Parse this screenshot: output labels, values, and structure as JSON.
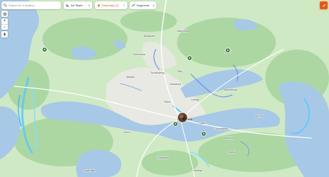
{
  "search": {
    "placeholder": "Search for a location",
    "value": ""
  },
  "toolbar": {
    "sport_label": "Ice Skate",
    "heatmaps_label": "Heatmaps (1)",
    "segments_label": "Segments"
  },
  "colors": {
    "accent": "#fc5200",
    "land": "#cfe9c4",
    "forest": "#a9d6a0",
    "water": "#a7c8e6",
    "heat": "#5bc8ff"
  },
  "map": {
    "places": [
      {
        "name": "Sjöbjacka",
        "kind": "label"
      },
      {
        "name": "Ljusterö",
        "kind": "label"
      },
      {
        "name": "Vallentuna",
        "kind": "label"
      },
      {
        "name": "Sollentuna",
        "kind": "label"
      },
      {
        "name": "Täby",
        "kind": "label"
      },
      {
        "name": "Danderyd",
        "kind": "label"
      },
      {
        "name": "Järfälla",
        "kind": "label"
      },
      {
        "name": "Sundbyberg",
        "kind": "label"
      },
      {
        "name": "Lidingö",
        "kind": "label"
      },
      {
        "name": "Solna",
        "kind": "label"
      },
      {
        "name": "Stockholm",
        "kind": "city"
      },
      {
        "name": "Nacka",
        "kind": "label"
      },
      {
        "name": "Ekerö",
        "kind": "label"
      },
      {
        "name": "Huddinge",
        "kind": "label"
      },
      {
        "name": "Tyresö",
        "kind": "label"
      },
      {
        "name": "Värmdö",
        "kind": "label"
      },
      {
        "name": "Åkersberga",
        "kind": "label"
      },
      {
        "name": "Södertälje",
        "kind": "label"
      },
      {
        "name": "Vaxholm",
        "kind": "label"
      },
      {
        "name": "Gustavsberg",
        "kind": "label"
      },
      {
        "name": "Haninge",
        "kind": "label"
      }
    ],
    "pins": [
      "tree-pin",
      "tree-pin",
      "tree-pin",
      "tree-pin",
      "tree-pin",
      "photo-pin"
    ]
  }
}
